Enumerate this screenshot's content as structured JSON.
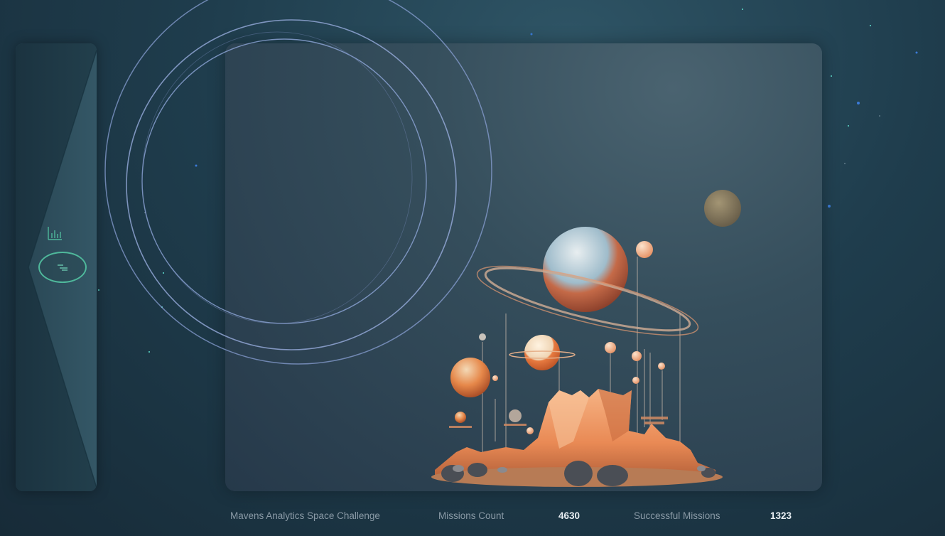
{
  "footer": {
    "app_title": "Mavens Analytics Space Challenge",
    "missions_count_label": "Missions Count",
    "missions_count_value": "4630",
    "successful_missions_label": "Successful Missions",
    "successful_missions_value": "1323"
  },
  "nav": {
    "items": [
      {
        "icon": "bar-chart-icon",
        "active": false
      },
      {
        "icon": "filter-icon",
        "active": true
      }
    ]
  },
  "colors": {
    "accent": "#4fb89b",
    "background": "#1f3d4d",
    "card": "#354e5c",
    "label_text": "#8a9aa6",
    "value_text": "#e8eef2"
  }
}
